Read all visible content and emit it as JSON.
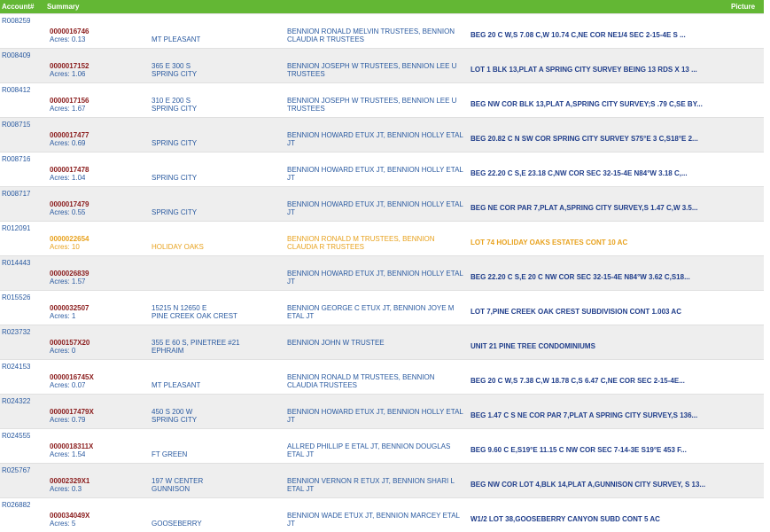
{
  "header": {
    "account_label": "Account#",
    "summary_label": "Summary",
    "picture_label": "Picture"
  },
  "rows": [
    {
      "account": "R008259",
      "number": "0000016746",
      "acres": "Acres: 0.13",
      "addr1": "",
      "addr2": "MT PLEASANT",
      "owner": "BENNION RONALD MELVIN TRUSTEES, BENNION CLAUDIA R TRUSTEES",
      "legal": "BEG 20 C W,S 7.08 C,W 10.74 C,NE COR NE1/4 SEC 2-15-4E S ..."
    },
    {
      "account": "R008409",
      "number": "0000017152",
      "acres": "Acres: 1.06",
      "addr1": "365 E 300 S",
      "addr2": "SPRING CITY",
      "owner": "BENNION JOSEPH W TRUSTEES, BENNION LEE U TRUSTEES",
      "legal": "LOT 1 BLK 13,PLAT A SPRING CITY SURVEY BEING 13 RDS X 13 ..."
    },
    {
      "account": "R008412",
      "number": "0000017156",
      "acres": "Acres: 1.67",
      "addr1": "310 E 200 S",
      "addr2": "SPRING CITY",
      "owner": "BENNION JOSEPH W TRUSTEES, BENNION LEE U TRUSTEES",
      "legal": "BEG NW COR BLK 13,PLAT A,SPRING CITY SURVEY;S .79 C,SE BY..."
    },
    {
      "account": "R008715",
      "number": "0000017477",
      "acres": "Acres: 0.69",
      "addr1": "",
      "addr2": "SPRING CITY",
      "owner": "BENNION HOWARD ETUX JT, BENNION HOLLY ETAL JT",
      "legal": "BEG 20.82 C N SW COR SPRING CITY SURVEY S75°E 3 C,S18°E 2..."
    },
    {
      "account": "R008716",
      "number": "0000017478",
      "acres": "Acres: 1.04",
      "addr1": "",
      "addr2": "SPRING CITY",
      "owner": "BENNION HOWARD ETUX JT, BENNION HOLLY ETAL JT",
      "legal": "BEG 22.20 C S,E 23.18 C,NW COR SEC 32-15-4E N84°W 3.18 C,..."
    },
    {
      "account": "R008717",
      "number": "0000017479",
      "acres": "Acres: 0.55",
      "addr1": "",
      "addr2": "SPRING CITY",
      "owner": "BENNION HOWARD ETUX JT, BENNION HOLLY ETAL JT",
      "legal": "BEG NE COR PAR 7,PLAT A,SPRING CITY SURVEY,S 1.47 C,W 3.5..."
    },
    {
      "account": "R012091",
      "number": "0000022654",
      "acres": "Acres: 10",
      "addr1": "",
      "addr2": "HOLIDAY OAKS",
      "owner": "BENNION RONALD M TRUSTEES, BENNION CLAUDIA R TRUSTEES",
      "legal": "LOT 74 HOLIDAY OAKS ESTATES CONT 10 AC",
      "highlight": true
    },
    {
      "account": "R014443",
      "number": "0000026839",
      "acres": "Acres: 1.57",
      "addr1": "",
      "addr2": "",
      "owner": "BENNION HOWARD ETUX JT, BENNION HOLLY ETAL JT",
      "legal": "BEG 22.20 C S,E 20 C NW COR SEC 32-15-4E N84°W 3.62 C,S18..."
    },
    {
      "account": "R015526",
      "number": "0000032507",
      "acres": "Acres: 1",
      "addr1": "15215 N 12650 E",
      "addr2": "PINE CREEK OAK CREST",
      "owner": "BENNION GEORGE C ETUX JT, BENNION JOYE M ETAL JT",
      "legal": "LOT 7,PINE CREEK OAK CREST SUBDIVISION CONT 1.003 AC"
    },
    {
      "account": "R023732",
      "number": "0000157X20",
      "acres": "Acres: 0",
      "addr1": "355 E 60 S, PINETREE #21",
      "addr2": "EPHRAIM",
      "owner": "BENNION JOHN W TRUSTEE",
      "legal": "UNIT 21 PINE TREE CONDOMINIUMS"
    },
    {
      "account": "R024153",
      "number": "0000016745X",
      "acres": "Acres: 0.07",
      "addr1": "",
      "addr2": "MT PLEASANT",
      "owner": "BENNION RONALD M TRUSTEES, BENNION CLAUDIA TRUSTEES",
      "legal": "BEG 20 C W,S 7.38 C,W 18.78 C,S 6.47 C,NE COR SEC 2-15-4E..."
    },
    {
      "account": "R024322",
      "number": "0000017479X",
      "acres": "Acres: 0.79",
      "addr1": "450 S 200 W",
      "addr2": "SPRING CITY",
      "owner": "BENNION HOWARD ETUX JT, BENNION HOLLY ETAL JT",
      "legal": "BEG 1.47 C S NE COR PAR 7,PLAT A SPRING CITY SURVEY,S 136..."
    },
    {
      "account": "R024555",
      "number": "0000018311X",
      "acres": "Acres: 1.54",
      "addr1": "",
      "addr2": "FT GREEN",
      "owner": "ALLRED PHILLIP E ETAL JT, BENNION DOUGLAS ETAL JT",
      "legal": "BEG 9.60 C E,S19°E 11.15 C NW COR SEC 7-14-3E S19°E 453 F..."
    },
    {
      "account": "R025767",
      "number": "00002329X1",
      "acres": "Acres: 0.3",
      "addr1": "197 W CENTER",
      "addr2": "GUNNISON",
      "owner": "BENNION VERNON R ETUX JT, BENNION SHARI L ETAL JT",
      "legal": "BEG NW COR LOT 4,BLK 14,PLAT A,GUNNISON CITY SURVEY, S 13..."
    },
    {
      "account": "R026882",
      "number": "000034049X",
      "acres": "Acres: 5",
      "addr1": "",
      "addr2": "GOOSEBERRY",
      "owner": "BENNION WADE ETUX JT, BENNION MARCEY ETAL JT",
      "legal": "W1/2 LOT 38,GOOSEBERRY CANYON SUBD CONT 5 AC"
    }
  ]
}
